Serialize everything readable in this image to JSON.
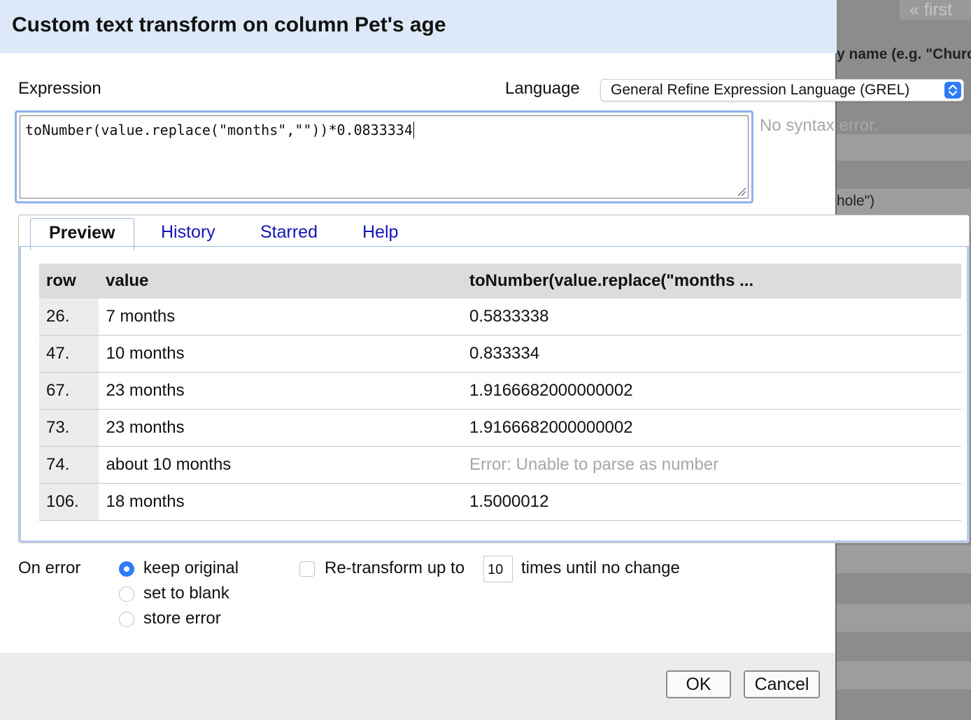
{
  "background": {
    "first_link": "« first",
    "header_text": "y name (e.g. \"Churc",
    "row_text": "hole\")"
  },
  "dialog": {
    "title": "Custom text transform on column Pet's age",
    "expression_label": "Expression",
    "language_label": "Language",
    "language_value": "General Refine Expression Language (GREL)",
    "expression": "toNumber(value.replace(\"months\",\"\"))*0.0833334",
    "status": "No syntax error."
  },
  "tabs": [
    {
      "label": "Preview",
      "active": true
    },
    {
      "label": "History",
      "active": false
    },
    {
      "label": "Starred",
      "active": false
    },
    {
      "label": "Help",
      "active": false
    }
  ],
  "preview": {
    "headers": [
      "row",
      "value",
      "toNumber(value.replace(\"months ..."
    ],
    "rows": [
      {
        "row": "26.",
        "value": "7 months",
        "result": "0.5833338",
        "error": false
      },
      {
        "row": "47.",
        "value": "10 months",
        "result": "0.833334",
        "error": false
      },
      {
        "row": "67.",
        "value": "23 months",
        "result": "1.9166682000000002",
        "error": false
      },
      {
        "row": "73.",
        "value": "23 months",
        "result": "1.9166682000000002",
        "error": false
      },
      {
        "row": "74.",
        "value": "about 10 months",
        "result": "Error: Unable to parse as number",
        "error": true
      },
      {
        "row": "106.",
        "value": "18 months",
        "result": "1.5000012",
        "error": false
      }
    ]
  },
  "on_error": {
    "label": "On error",
    "options": [
      {
        "label": "keep original",
        "selected": true
      },
      {
        "label": "set to blank",
        "selected": false
      },
      {
        "label": "store error",
        "selected": false
      }
    ]
  },
  "retransform": {
    "prefix": "Re-transform up to",
    "count": "10",
    "suffix": "times until no change",
    "checked": false
  },
  "buttons": {
    "ok": "OK",
    "cancel": "Cancel"
  },
  "colors": {
    "accent": "#2f7cf6",
    "header_bg": "#dde9f8",
    "link": "#1414b8",
    "error_text": "#a6a6a6"
  }
}
